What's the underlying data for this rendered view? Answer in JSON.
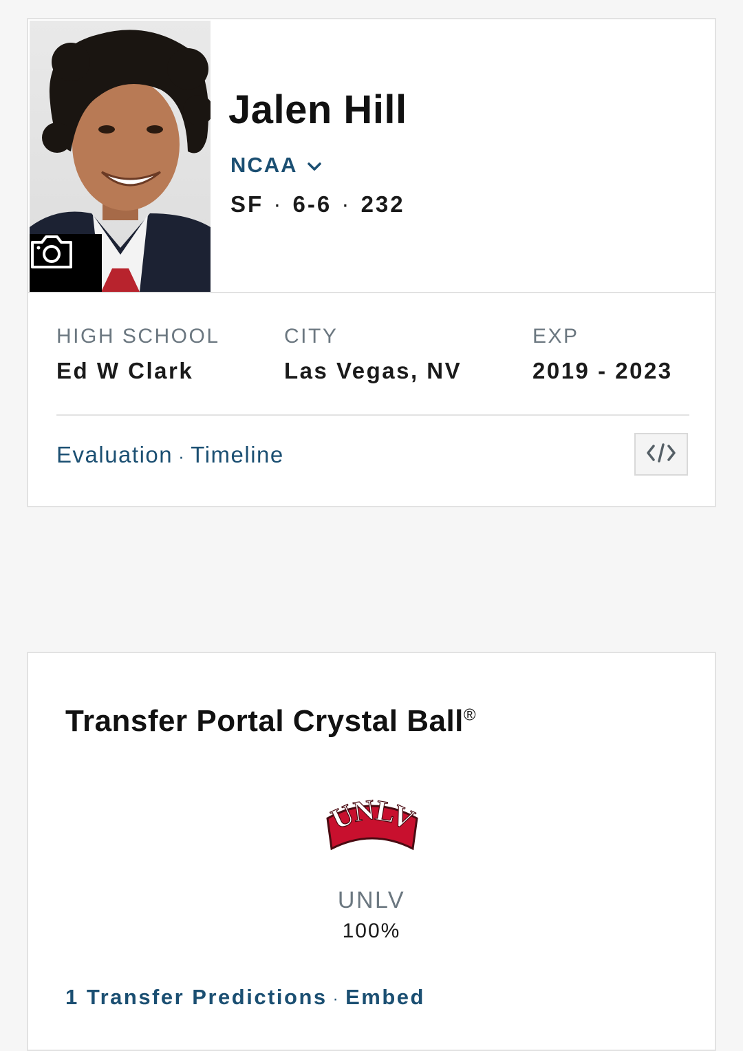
{
  "player": {
    "name": "Jalen Hill",
    "league": "NCAA",
    "position": "SF",
    "height": "6-6",
    "weight": "232",
    "vitals_separator": "·"
  },
  "info": {
    "high_school_label": "HIGH SCHOOL",
    "high_school_value": "Ed W Clark",
    "city_label": "CITY",
    "city_value": "Las Vegas, NV",
    "exp_label": "EXP",
    "exp_value": "2019 - 2023"
  },
  "links": {
    "evaluation": "Evaluation",
    "timeline": "Timeline",
    "separator": "·"
  },
  "icons": {
    "camera": "camera-icon",
    "chevron": "chevron-down-icon",
    "embed": "code-embed-icon"
  },
  "crystal_ball": {
    "title": "Transfer Portal Crystal Ball",
    "title_mark": "®",
    "team_name": "UNLV",
    "team_logo_text": "UNLV",
    "team_percent": "100%",
    "predictions_link": "1 Transfer Predictions",
    "embed_link": "Embed",
    "separator": "·"
  },
  "colors": {
    "link": "#1b4f72",
    "muted": "#6b7780",
    "unlv_red": "#c8102e"
  }
}
